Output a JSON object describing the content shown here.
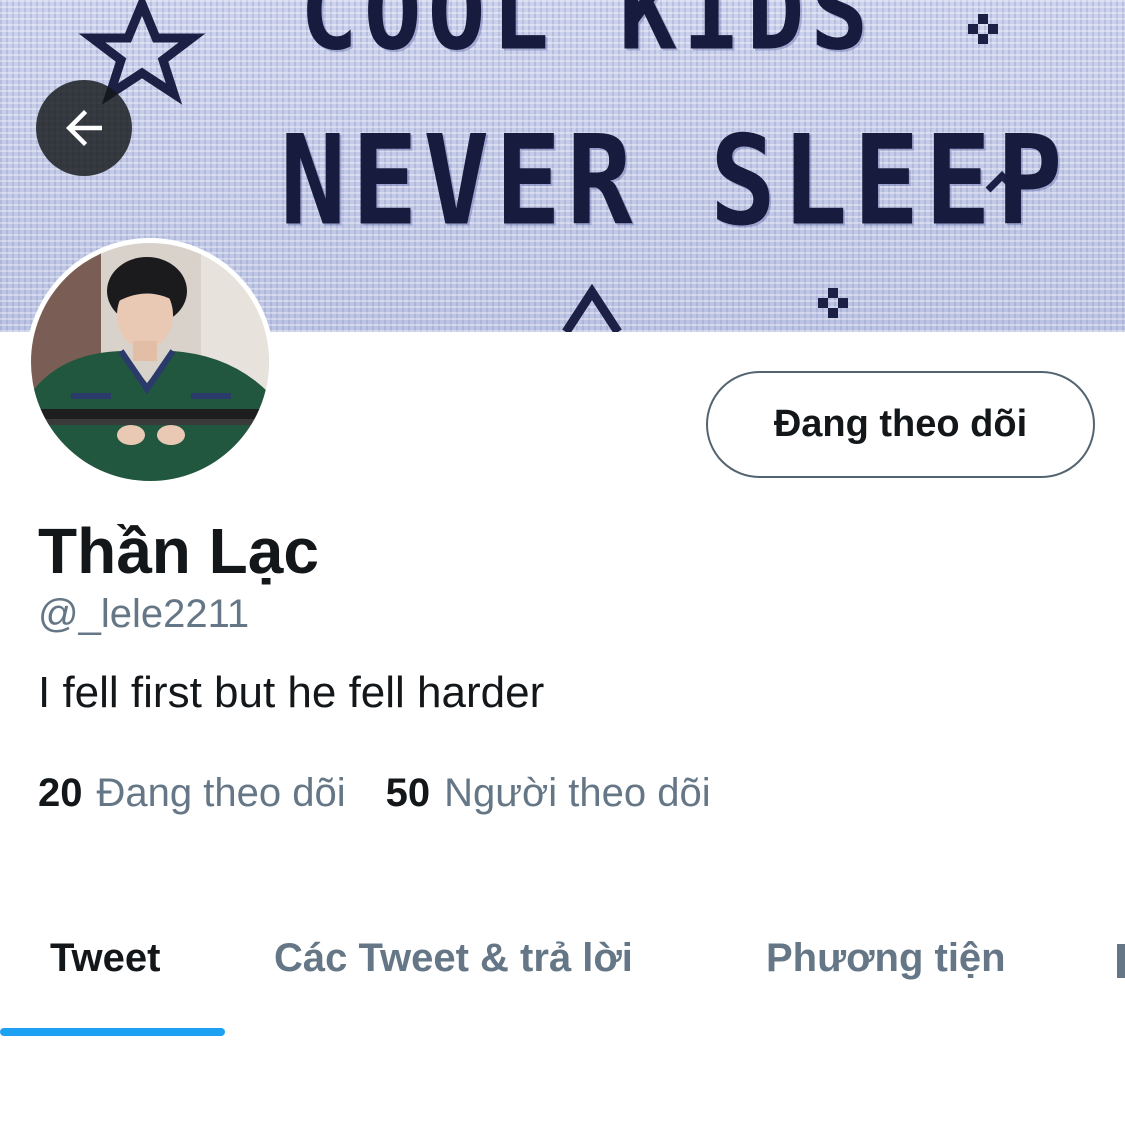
{
  "banner": {
    "line1": "COOL KIDS",
    "line2": "NEVER SLEEP"
  },
  "header": {
    "back_icon": "arrow-left-icon"
  },
  "profile": {
    "avatar_icon": "profile-photo",
    "display_name": "Thần Lạc",
    "handle": "@_lele2211",
    "bio": "I fell first but he fell harder",
    "follow_button_label": "Đang theo dõi"
  },
  "stats": {
    "following_count": "20",
    "following_label": "Đang theo dõi",
    "followers_count": "50",
    "followers_label": "Người theo dõi"
  },
  "tabs": [
    {
      "label": "Tweet",
      "active": true
    },
    {
      "label": "Các Tweet & trả lời",
      "active": false
    },
    {
      "label": "Phương tiện",
      "active": false
    }
  ],
  "colors": {
    "accent": "#1da1f2",
    "text_primary": "#14171a",
    "text_secondary": "#657786"
  }
}
